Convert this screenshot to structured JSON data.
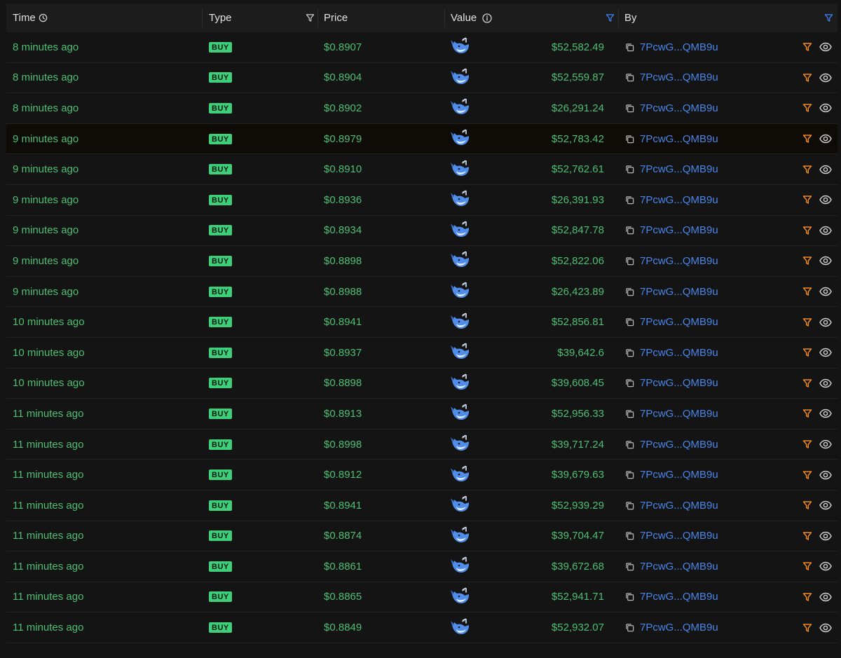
{
  "header": {
    "time": "Time",
    "type": "Type",
    "price": "Price",
    "value": "Value",
    "by": "By"
  },
  "colors": {
    "green": "#4fbf73",
    "badge": "#3ecf7a",
    "link": "#4a86e8",
    "filter_orange": "#f08a24",
    "filter_blue": "#3b82f6"
  },
  "icons": {
    "time_header": "clock-sort-icon",
    "type_filter": "filter-icon",
    "value_info": "info-icon",
    "value_filter": "filter-icon",
    "by_filter": "filter-icon",
    "row_value": "whale-icon",
    "row_copy": "copy-icon",
    "row_filter": "filter-icon",
    "row_view": "eye-icon"
  },
  "rows": [
    {
      "time": "8 minutes ago",
      "type": "BUY",
      "price": "$0.8907",
      "value": "$52,582.49",
      "by": "7PcwG...QMB9u"
    },
    {
      "time": "8 minutes ago",
      "type": "BUY",
      "price": "$0.8904",
      "value": "$52,559.87",
      "by": "7PcwG...QMB9u"
    },
    {
      "time": "8 minutes ago",
      "type": "BUY",
      "price": "$0.8902",
      "value": "$26,291.24",
      "by": "7PcwG...QMB9u"
    },
    {
      "time": "9 minutes ago",
      "type": "BUY",
      "price": "$0.8979",
      "value": "$52,783.42",
      "by": "7PcwG...QMB9u",
      "highlight": true
    },
    {
      "time": "9 minutes ago",
      "type": "BUY",
      "price": "$0.8910",
      "value": "$52,762.61",
      "by": "7PcwG...QMB9u"
    },
    {
      "time": "9 minutes ago",
      "type": "BUY",
      "price": "$0.8936",
      "value": "$26,391.93",
      "by": "7PcwG...QMB9u"
    },
    {
      "time": "9 minutes ago",
      "type": "BUY",
      "price": "$0.8934",
      "value": "$52,847.78",
      "by": "7PcwG...QMB9u"
    },
    {
      "time": "9 minutes ago",
      "type": "BUY",
      "price": "$0.8898",
      "value": "$52,822.06",
      "by": "7PcwG...QMB9u"
    },
    {
      "time": "9 minutes ago",
      "type": "BUY",
      "price": "$0.8988",
      "value": "$26,423.89",
      "by": "7PcwG...QMB9u"
    },
    {
      "time": "10 minutes ago",
      "type": "BUY",
      "price": "$0.8941",
      "value": "$52,856.81",
      "by": "7PcwG...QMB9u"
    },
    {
      "time": "10 minutes ago",
      "type": "BUY",
      "price": "$0.8937",
      "value": "$39,642.6",
      "by": "7PcwG...QMB9u"
    },
    {
      "time": "10 minutes ago",
      "type": "BUY",
      "price": "$0.8898",
      "value": "$39,608.45",
      "by": "7PcwG...QMB9u"
    },
    {
      "time": "11 minutes ago",
      "type": "BUY",
      "price": "$0.8913",
      "value": "$52,956.33",
      "by": "7PcwG...QMB9u"
    },
    {
      "time": "11 minutes ago",
      "type": "BUY",
      "price": "$0.8998",
      "value": "$39,717.24",
      "by": "7PcwG...QMB9u"
    },
    {
      "time": "11 minutes ago",
      "type": "BUY",
      "price": "$0.8912",
      "value": "$39,679.63",
      "by": "7PcwG...QMB9u"
    },
    {
      "time": "11 minutes ago",
      "type": "BUY",
      "price": "$0.8941",
      "value": "$52,939.29",
      "by": "7PcwG...QMB9u"
    },
    {
      "time": "11 minutes ago",
      "type": "BUY",
      "price": "$0.8874",
      "value": "$39,704.47",
      "by": "7PcwG...QMB9u"
    },
    {
      "time": "11 minutes ago",
      "type": "BUY",
      "price": "$0.8861",
      "value": "$39,672.68",
      "by": "7PcwG...QMB9u"
    },
    {
      "time": "11 minutes ago",
      "type": "BUY",
      "price": "$0.8865",
      "value": "$52,941.71",
      "by": "7PcwG...QMB9u"
    },
    {
      "time": "11 minutes ago",
      "type": "BUY",
      "price": "$0.8849",
      "value": "$52,932.07",
      "by": "7PcwG...QMB9u"
    }
  ]
}
